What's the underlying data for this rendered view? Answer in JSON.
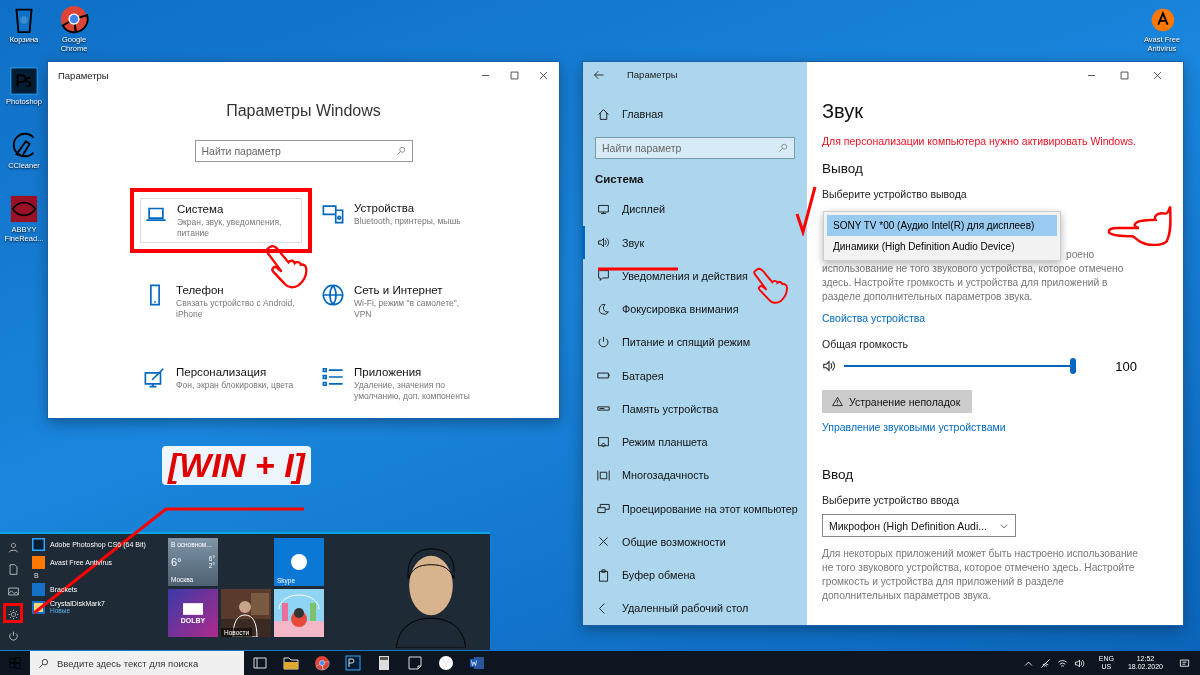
{
  "desktop_icons": [
    {
      "kind": "bin",
      "label": "Корзина"
    },
    {
      "kind": "chrome",
      "label": "Google Chrome"
    },
    {
      "kind": "ps",
      "label": "Photoshop"
    },
    {
      "kind": "ccleaner",
      "label": "CCleaner"
    },
    {
      "kind": "abbyy",
      "label": "ABBYY FineRead..."
    },
    {
      "kind": "avast",
      "label": "Avast Free Antivirus"
    }
  ],
  "settings_home": {
    "title": "Параметры",
    "heading": "Параметры Windows",
    "search": {
      "placeholder": "Найти параметр"
    },
    "categories": [
      {
        "kind": "laptop",
        "name": "Система",
        "description": "Экран, звук, уведомления, питание",
        "highlighted": true
      },
      {
        "kind": "devices",
        "name": "Устройства",
        "description": "Bluetooth, принтеры, мышь",
        "highlighted": false
      },
      {
        "kind": "phone",
        "name": "Телефон",
        "description": "Связать устройство с Android, iPhone",
        "highlighted": false
      },
      {
        "kind": "globe",
        "name": "Сеть и Интернет",
        "description": "Wi-Fi, режим \"в самолете\", VPN",
        "highlighted": false
      },
      {
        "kind": "paint",
        "name": "Персонализация",
        "description": "Фон, экран блокировки, цвета",
        "highlighted": false
      },
      {
        "kind": "apps",
        "name": "Приложения",
        "description": "Удаление, значения по умолчанию, доп. компоненты",
        "highlighted": false
      }
    ]
  },
  "annotation": {
    "text": "[WIN + I]"
  },
  "sound_window": {
    "title": "Параметры",
    "home": "Главная",
    "search": {
      "placeholder": "Найти параметр"
    },
    "section": "Система",
    "nav_items": [
      {
        "kind": "display",
        "label": "Дисплей",
        "selected": false
      },
      {
        "kind": "sound",
        "label": "Звук",
        "selected": true
      },
      {
        "kind": "notify",
        "label": "Уведомления и действия",
        "selected": false
      },
      {
        "kind": "focus",
        "label": "Фокусировка внимания",
        "selected": false
      },
      {
        "kind": "power",
        "label": "Питание и спящий режим",
        "selected": false
      },
      {
        "kind": "battery",
        "label": "Батарея",
        "selected": false
      },
      {
        "kind": "storage",
        "label": "Память устройства",
        "selected": false
      },
      {
        "kind": "tablet",
        "label": "Режим планшета",
        "selected": false
      },
      {
        "kind": "multitask",
        "label": "Многозадачность",
        "selected": false
      },
      {
        "kind": "project",
        "label": "Проецирование на этот компьютер",
        "selected": false
      },
      {
        "kind": "access",
        "label": "Общие возможности",
        "selected": false
      },
      {
        "kind": "clipboard",
        "label": "Буфер обмена",
        "selected": false
      },
      {
        "kind": "remote",
        "label": "Удаленный рабочий стол",
        "selected": false
      }
    ],
    "heading": "Звук",
    "warning": "Для персонализации компьютера нужно активировать Windows.",
    "output": {
      "heading": "Вывод",
      "label": "Выберите устройство вывода",
      "options": [
        {
          "label": "SONY TV  *00 (Аудио Intel(R) для дисплеев)",
          "selected": true
        },
        {
          "label": "Динамики (High Definition Audio Device)",
          "selected": false
        }
      ],
      "note_first_visible": "роено",
      "note_rest": "использование не того звукового устройства, которое отмечено здесь. Настройте громкость и устройства для приложений в разделе дополнительных параметров звука.",
      "properties_link": "Свойства устройства",
      "volume_label": "Общая громкость",
      "volume": {
        "level": 1
      },
      "volume_reading": "100",
      "troubleshoot": "Устранение неполадок",
      "manage_link": "Управление звуковыми устройствами"
    },
    "input": {
      "heading": "Ввод",
      "label": "Выберите устройство ввода",
      "value": "Микрофон (High Definition Audi...",
      "note": "Для некоторых приложений может быть настроено использование не того звукового устройства, которое отмечено здесь. Настройте громкость и устройства для приложений в разделе дополнительных параметров звука."
    }
  },
  "start_menu": {
    "apps": [
      {
        "kind": "app",
        "label": "Adobe Photoshop CS6 (64 Bit)"
      },
      {
        "kind": "app",
        "label": "Avast Free Antivirus"
      },
      {
        "kind": "letter",
        "label": "B"
      },
      {
        "kind": "app",
        "label": "Brackets"
      },
      {
        "kind": "app",
        "label": "CrystalDiskMark7",
        "sub": "Новые"
      }
    ],
    "weather": {
      "summary": "В основном...",
      "temp": "6°",
      "high": "6°",
      "low": "2°",
      "city": "Москва"
    },
    "skype": {
      "label": "Skype"
    },
    "dolby": {
      "label": "DOLBY"
    },
    "news": {
      "label": "Новости"
    }
  },
  "taskbar": {
    "search": {
      "placeholder": "Введите здесь текст для поиска"
    },
    "language": "ENG",
    "layout": "US",
    "time": "12:52",
    "date": "18.02.2020"
  }
}
